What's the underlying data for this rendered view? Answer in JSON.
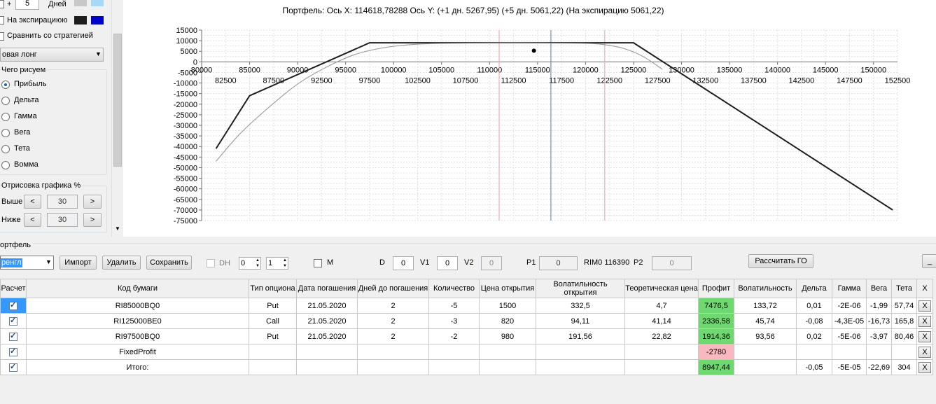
{
  "left": {
    "plus": "+",
    "days_value": "5",
    "days_label": "Дней",
    "swatch1_color": "#c8c8c8",
    "swatch2_color": "#a8d8f8",
    "expiry_label": "На экспирациюю",
    "expiry_colors": [
      "#1e1e1e",
      "#0000c8"
    ],
    "compare_label": "Сравнить со стратегией",
    "strategy_value": "овая лонг",
    "draw_group_title": "Чего рисуем",
    "radios": [
      "Прибыль",
      "Дельта",
      "Гамма",
      "Вега",
      "Тета",
      "Вомма"
    ],
    "render_group_title": "Отрисовка графика %",
    "above_label": "Выше",
    "below_label": "Ниже",
    "above_value": "30",
    "below_value": "30",
    "dec": "<",
    "inc": ">"
  },
  "chart_title": "Портфель: Ось X: 114618,78288 Ось Y:  (+1 дн. 5267,95)  (+5 дн. 5061,22)  (На экспирацию 5061,22)",
  "chart_data": {
    "type": "line",
    "xlim": [
      80000,
      152500
    ],
    "ylim": [
      -75000,
      15000
    ],
    "x_ticks_top": [
      "80000",
      "85000",
      "90000",
      "95000",
      "100000",
      "105000",
      "110000",
      "115000",
      "120000",
      "125000",
      "130000",
      "135000",
      "140000",
      "145000",
      "150000"
    ],
    "x_ticks_bottom": [
      "82500",
      "87500",
      "92500",
      "97500",
      "102500",
      "107500",
      "112500",
      "117500",
      "122500",
      "127500",
      "132500",
      "137500",
      "142500",
      "147500",
      "152500"
    ],
    "y_ticks": [
      "15000",
      "10000",
      "5000",
      "0",
      "-5000",
      "-10000",
      "-15000",
      "-20000",
      "-25000",
      "-30000",
      "-35000",
      "-40000",
      "-45000",
      "-50000",
      "-55000",
      "-60000",
      "-65000",
      "-70000",
      "-75000"
    ],
    "vertical_lines": [
      {
        "x": 111000,
        "color": "#f0a0a8"
      },
      {
        "x": 116390,
        "color": "#5a7a9a"
      },
      {
        "x": 122000,
        "color": "#f0a0a8"
      }
    ],
    "marker": {
      "x": 114618,
      "y": 5267
    },
    "series": [
      {
        "color": "#1e1e1e",
        "x": [
          81500,
          85000,
          97500,
          125000,
          152000
        ],
        "y": [
          -41000,
          -16000,
          9000,
          9000,
          -70000
        ]
      },
      {
        "color": "#a0a0a0",
        "x": [
          81500,
          84000,
          87000,
          90000,
          93000,
          96000,
          99000,
          102000,
          105000,
          110000,
          115000,
          120000,
          122000,
          124000,
          126000,
          128000
        ],
        "y": [
          -47000,
          -34000,
          -21500,
          -10500,
          -2500,
          3500,
          6700,
          8200,
          8700,
          8900,
          8900,
          8700,
          8100,
          6300,
          2500,
          -3500
        ]
      }
    ]
  },
  "bottom": {
    "portfolio_label": "ортфель",
    "portfolio_select": "ренгл",
    "import_btn": "Импорт",
    "delete_btn": "Удалить",
    "save_btn": "Сохранить",
    "dh_label": "DH",
    "spin1": "0",
    "spin2": "1",
    "m_label": "M",
    "d_label": "D",
    "d_value": "0",
    "v1_label": "V1",
    "v1_value": "0",
    "v2_label": "V2",
    "v2_value": "0",
    "p1_label": "P1",
    "p1_value": "0",
    "rim_label": "RIM0 116390",
    "p2_label": "P2",
    "p2_value": "0",
    "calc_btn": "Рассчитать ГО",
    "min_btn": "_"
  },
  "table": {
    "headers": [
      "Расчет",
      "Код бумаги",
      "Тип опциона",
      "Дата погашения",
      "Дней до погашения",
      "Количество",
      "Цена открытия",
      "Волатильность открытия",
      "Теоретическая цена",
      "Профит",
      "Волатильность",
      "Дельта",
      "Гамма",
      "Вега",
      "Тета",
      "X"
    ],
    "rows": [
      [
        "",
        "RI85000BQ0",
        "Put",
        "21.05.2020",
        "2",
        "-5",
        "1500",
        "332,5",
        "4,7",
        "7476,5",
        "133,72",
        "0,01",
        "-2E-06",
        "-1,99",
        "57,74",
        "X"
      ],
      [
        "",
        "RI125000BE0",
        "Call",
        "21.05.2020",
        "2",
        "-3",
        "820",
        "94,11",
        "41,14",
        "2336,58",
        "45,74",
        "-0,08",
        "-4,3E-05",
        "-16,73",
        "165,8",
        "X"
      ],
      [
        "",
        "RI97500BQ0",
        "Put",
        "21.05.2020",
        "2",
        "-2",
        "980",
        "191,56",
        "22,82",
        "1914,36",
        "93,56",
        "0,02",
        "-5E-06",
        "-3,97",
        "80,46",
        "X"
      ],
      [
        "",
        "FixedProfit",
        "",
        "",
        "",
        "",
        "",
        "",
        "",
        "-2780",
        "",
        "",
        "",
        "",
        "",
        "X"
      ],
      [
        "",
        "Итого:",
        "",
        "",
        "",
        "",
        "",
        "",
        "",
        "8947,44",
        "",
        "-0,05",
        "-5E-05",
        "-22,69",
        "304",
        "X"
      ]
    ]
  }
}
